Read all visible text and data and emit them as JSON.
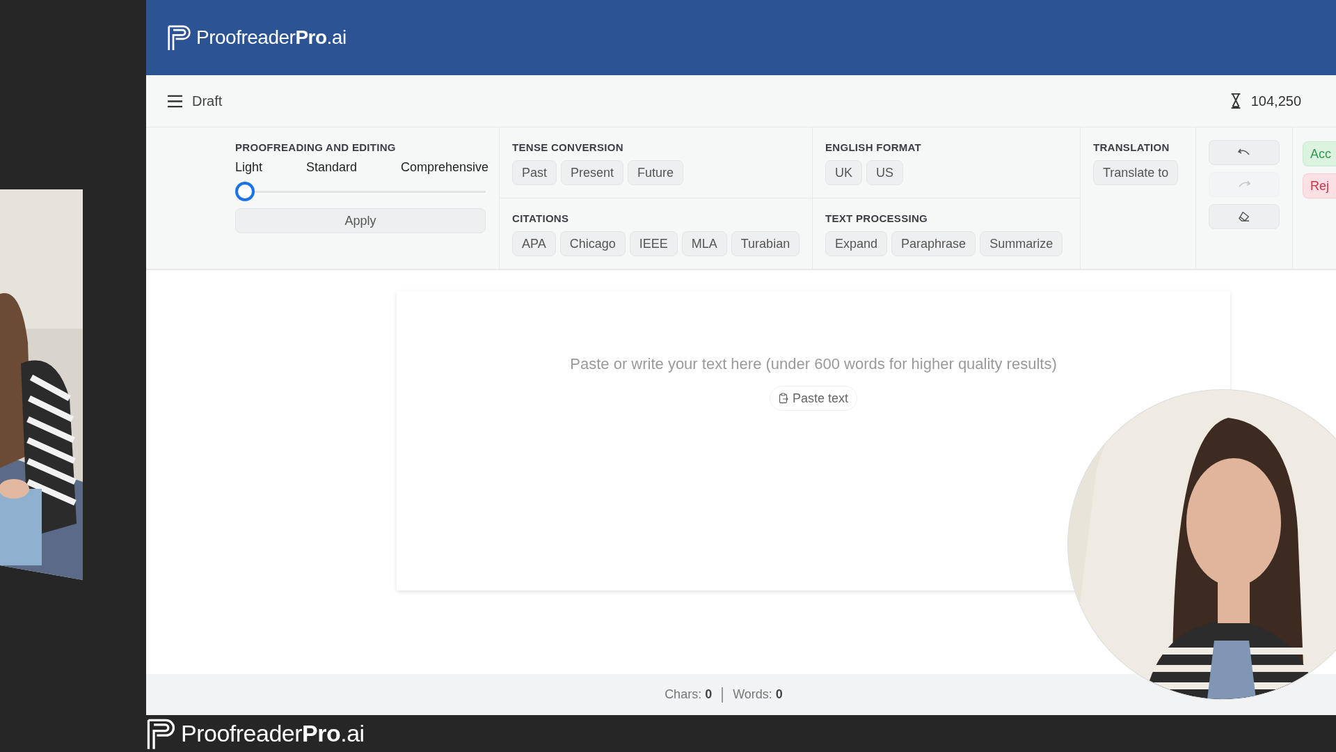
{
  "header": {
    "logo": "Proofreader**Pro**.ai"
  },
  "toolbar": {
    "document": "Draft",
    "credits": "104,250"
  },
  "proofreading": {
    "title": "PROOFREADING AND EDITING",
    "levels": [
      "Light",
      "Standard",
      "Comprehensive"
    ],
    "level": 0,
    "apply": "Apply"
  },
  "tense_conversion": {
    "title": "TENSE CONVERSION",
    "buttons": [
      "Past",
      "Present",
      "Future"
    ]
  },
  "citations": {
    "title": "CITATIONS",
    "buttons": [
      "APA",
      "Chicago",
      "IEEE",
      "MLA",
      "Turabian"
    ]
  },
  "english_format": {
    "title": "ENGLISH FORMAT",
    "buttons": [
      "UK",
      "US"
    ]
  },
  "text_processing": {
    "title": "TEXT PROCESSING",
    "buttons": [
      "Expand",
      "Paraphrase",
      "Summarize"
    ]
  },
  "translation": {
    "title": "TRANSLATION",
    "button": "Translate to"
  },
  "history": [
    {
      "kind": "undo",
      "disabled": false
    },
    {
      "kind": "redo",
      "disabled": true
    },
    {
      "kind": "clear",
      "disabled": false
    }
  ],
  "review": [
    {
      "kind": "accept",
      "label": "Acc"
    },
    {
      "kind": "reject",
      "label": "Rej"
    }
  ],
  "editor": {
    "placeholder": "Paste or write your text here (under 600 words for higher quality results)",
    "paste_button": "Paste text"
  },
  "status_bar": {
    "chars_label": "Chars:",
    "chars": "0",
    "words_label": "Words:",
    "words": "0"
  },
  "footer": {
    "logo": "Proofreader**Pro**.ai"
  }
}
